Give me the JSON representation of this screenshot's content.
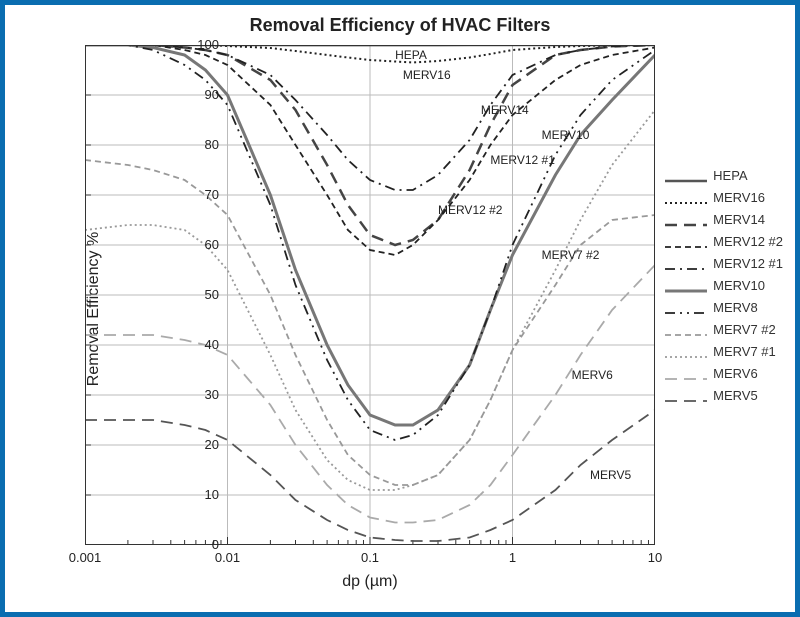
{
  "chart_data": {
    "type": "line",
    "title": "Removal Efficiency of HVAC Filters",
    "xlabel": "dp (µm)",
    "ylabel": "Removal Efficiency %",
    "x_scale": "log",
    "xlim": [
      0.001,
      10
    ],
    "ylim": [
      0,
      100
    ],
    "x_ticks": [
      0.001,
      0.01,
      0.1,
      1,
      10
    ],
    "y_ticks": [
      0,
      10,
      20,
      30,
      40,
      50,
      60,
      70,
      80,
      90,
      100
    ],
    "x": [
      0.001,
      0.002,
      0.003,
      0.005,
      0.007,
      0.01,
      0.02,
      0.03,
      0.05,
      0.07,
      0.1,
      0.15,
      0.2,
      0.3,
      0.5,
      0.7,
      1,
      2,
      3,
      5,
      10
    ],
    "series": [
      {
        "name": "HEPA",
        "style": "solid",
        "color": "#555",
        "width": 2.5,
        "values": [
          100,
          100,
          100,
          100,
          100,
          100,
          99.99,
          99.98,
          99.97,
          99.97,
          99.97,
          99.97,
          99.97,
          99.98,
          99.99,
          100,
          100,
          100,
          100,
          100,
          100
        ]
      },
      {
        "name": "MERV16",
        "style": "dot",
        "color": "#222",
        "width": 2,
        "values": [
          100,
          100,
          100,
          100,
          100,
          99.8,
          99.4,
          98.8,
          98,
          97.5,
          97,
          96.7,
          96.5,
          96.8,
          97.5,
          98.2,
          99,
          99.6,
          99.8,
          99.9,
          100
        ]
      },
      {
        "name": "MERV14",
        "style": "longdash",
        "color": "#444",
        "width": 2.5,
        "values": [
          100,
          100,
          100,
          99.5,
          99,
          98,
          93,
          87,
          76,
          68,
          62,
          60,
          61,
          65,
          75,
          84,
          92,
          98,
          99,
          99.7,
          100
        ]
      },
      {
        "name": "MERV12 #2",
        "style": "shortdash",
        "color": "#222",
        "width": 1.8,
        "values": [
          100,
          100,
          100,
          99,
          98,
          96,
          88,
          80,
          70,
          63,
          59,
          58,
          60,
          65,
          73,
          80,
          86,
          93,
          96,
          98,
          99.5
        ]
      },
      {
        "name": "MERV12 #1",
        "style": "dashdot",
        "color": "#222",
        "width": 1.8,
        "values": [
          100,
          100,
          100,
          99.5,
          99,
          98,
          94,
          89,
          82,
          77,
          73,
          71,
          71,
          74,
          81,
          88,
          94,
          98,
          99,
          99.7,
          100
        ]
      },
      {
        "name": "MERV10",
        "style": "solid",
        "color": "#777",
        "width": 3,
        "values": [
          100,
          100,
          99.5,
          98,
          95,
          90,
          70,
          55,
          40,
          32,
          26,
          24,
          24,
          27,
          36,
          47,
          58,
          74,
          82,
          89,
          98
        ]
      },
      {
        "name": "MERV8",
        "style": "dashdotdot",
        "color": "#222",
        "width": 1.8,
        "values": [
          100,
          100,
          99,
          96,
          93,
          88,
          68,
          52,
          37,
          29,
          23,
          21,
          22,
          26,
          36,
          47,
          60,
          78,
          86,
          93,
          99
        ]
      },
      {
        "name": "MERV7 #2",
        "style": "shortdash",
        "color": "#999",
        "width": 1.8,
        "values": [
          77,
          76,
          75,
          73,
          70,
          66,
          50,
          38,
          25,
          18,
          14,
          12,
          12,
          14,
          21,
          29,
          39,
          52,
          60,
          65,
          66
        ]
      },
      {
        "name": "MERV7 #1",
        "style": "dot",
        "color": "#999",
        "width": 1.8,
        "values": [
          63,
          64,
          64,
          63,
          60,
          55,
          38,
          27,
          17,
          13,
          11,
          11,
          12,
          14,
          21,
          29,
          39,
          55,
          65,
          76,
          87
        ]
      },
      {
        "name": "MERV6",
        "style": "longdash",
        "color": "#aaa",
        "width": 1.8,
        "values": [
          42,
          42,
          42,
          41,
          40,
          38,
          28,
          20,
          12,
          8,
          5.5,
          4.5,
          4.5,
          5,
          8,
          12,
          18,
          30,
          38,
          47,
          56
        ]
      },
      {
        "name": "MERV5",
        "style": "longdash",
        "color": "#555",
        "width": 1.8,
        "values": [
          25,
          25,
          25,
          24,
          23,
          21,
          14,
          9,
          5,
          3,
          1.5,
          1,
          0.8,
          0.8,
          1.5,
          3,
          5,
          11,
          16,
          21,
          27
        ]
      }
    ],
    "annotations": [
      {
        "text": "HEPA",
        "xy": [
          0.15,
          98
        ]
      },
      {
        "text": "MERV16",
        "xy": [
          0.17,
          94
        ]
      },
      {
        "text": "MERV14",
        "xy": [
          0.6,
          87
        ]
      },
      {
        "text": "MERV10",
        "xy": [
          1.6,
          82
        ]
      },
      {
        "text": "MERV12 #1",
        "xy": [
          0.7,
          77
        ]
      },
      {
        "text": "MERV12 #2",
        "xy": [
          0.3,
          67
        ]
      },
      {
        "text": "MERV7 #2",
        "xy": [
          1.6,
          58
        ]
      },
      {
        "text": "MERV6",
        "xy": [
          2.6,
          34
        ]
      },
      {
        "text": "MERV5",
        "xy": [
          3.5,
          14
        ]
      }
    ]
  },
  "legend_header": ""
}
